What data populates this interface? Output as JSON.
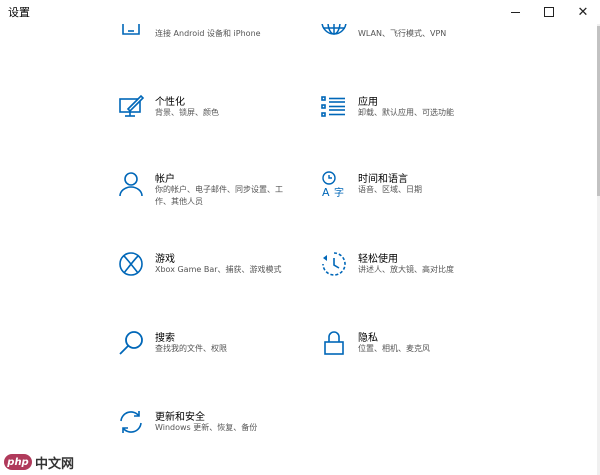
{
  "window": {
    "title": "设置",
    "minimize_icon": "minimize-icon",
    "maximize_icon": "maximize-icon",
    "close_icon": "close-icon",
    "close_glyph": "✕"
  },
  "tiles": [
    {
      "name": "",
      "desc": "连接 Android 设备和 iPhone",
      "icon": "phone-icon"
    },
    {
      "name": "",
      "desc": "WLAN、飞行模式、VPN",
      "icon": "network-globe-icon"
    },
    {
      "name": "个性化",
      "desc": "背景、锁屏、颜色",
      "icon": "personalization-icon"
    },
    {
      "name": "应用",
      "desc": "卸载、默认应用、可选功能",
      "icon": "apps-list-icon"
    },
    {
      "name": "帐户",
      "desc": "你的帐户、电子邮件、同步设置、工作、其他人员",
      "icon": "account-person-icon"
    },
    {
      "name": "时间和语言",
      "desc": "语音、区域、日期",
      "icon": "time-language-icon"
    },
    {
      "name": "游戏",
      "desc": "Xbox Game Bar、捕获、游戏模式",
      "icon": "xbox-icon"
    },
    {
      "name": "轻松使用",
      "desc": "讲述人、放大镜、高对比度",
      "icon": "ease-of-access-icon"
    },
    {
      "name": "搜索",
      "desc": "查找我的文件、权限",
      "icon": "search-icon"
    },
    {
      "name": "隐私",
      "desc": "位置、相机、麦克风",
      "icon": "lock-icon"
    },
    {
      "name": "更新和安全",
      "desc": "Windows 更新、恢复、备份",
      "icon": "update-sync-icon"
    }
  ],
  "watermark": {
    "logo": "php",
    "text": "中文网"
  },
  "colors": {
    "accent": "#0067b8",
    "watermark": "#b03a5b"
  }
}
